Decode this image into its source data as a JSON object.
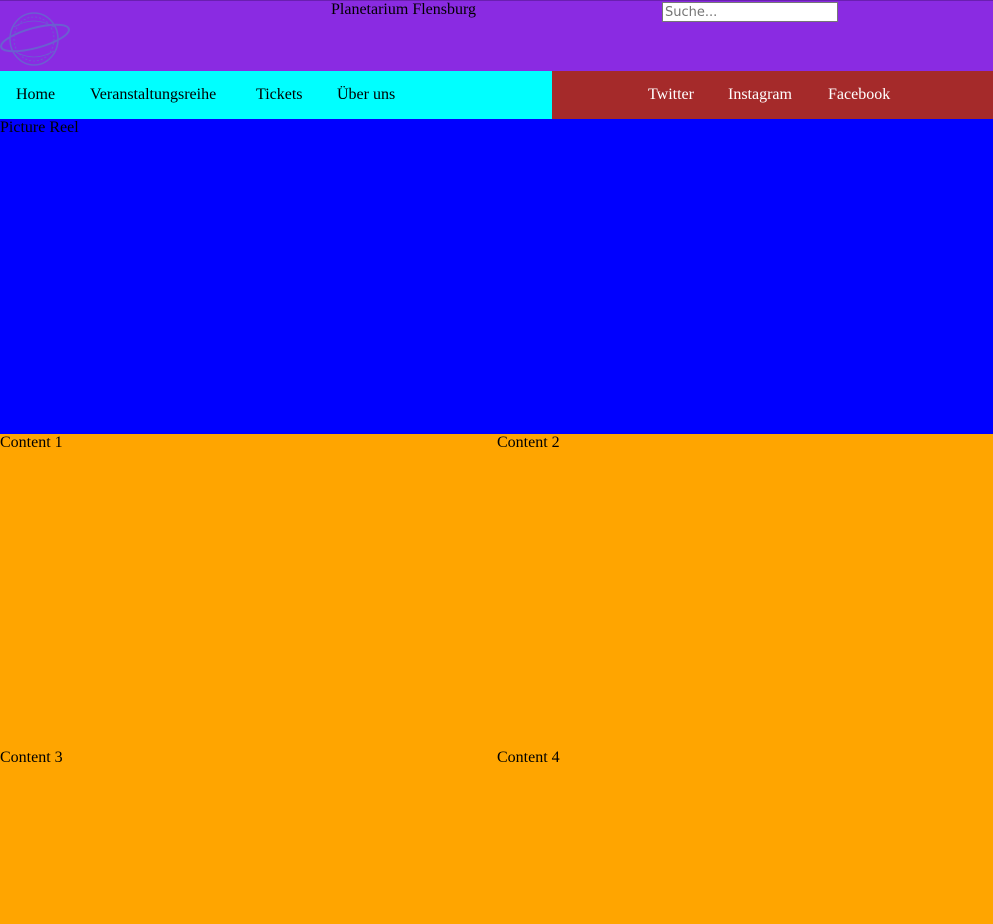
{
  "header": {
    "title": "Planetarium Flensburg",
    "logo_icon": "planet-ring-logo",
    "background_color": "#8a2be2"
  },
  "search": {
    "placeholder": "Suche...",
    "value": ""
  },
  "nav": {
    "items": [
      {
        "label": "Home"
      },
      {
        "label": "Veranstaltungsreihe"
      },
      {
        "label": "Tickets"
      },
      {
        "label": "Über uns"
      }
    ],
    "background_color": "#00ffff"
  },
  "social": {
    "items": [
      {
        "label": "Twitter"
      },
      {
        "label": "Instagram"
      },
      {
        "label": "Facebook"
      }
    ],
    "background_color": "#a52a2a"
  },
  "picture_reel": {
    "label": "Picture Reel",
    "background_color": "#0000ff"
  },
  "content": [
    {
      "label": "Content 1"
    },
    {
      "label": "Content 2"
    },
    {
      "label": "Content 3"
    },
    {
      "label": "Content 4"
    }
  ],
  "content_background_color": "#ffa500"
}
